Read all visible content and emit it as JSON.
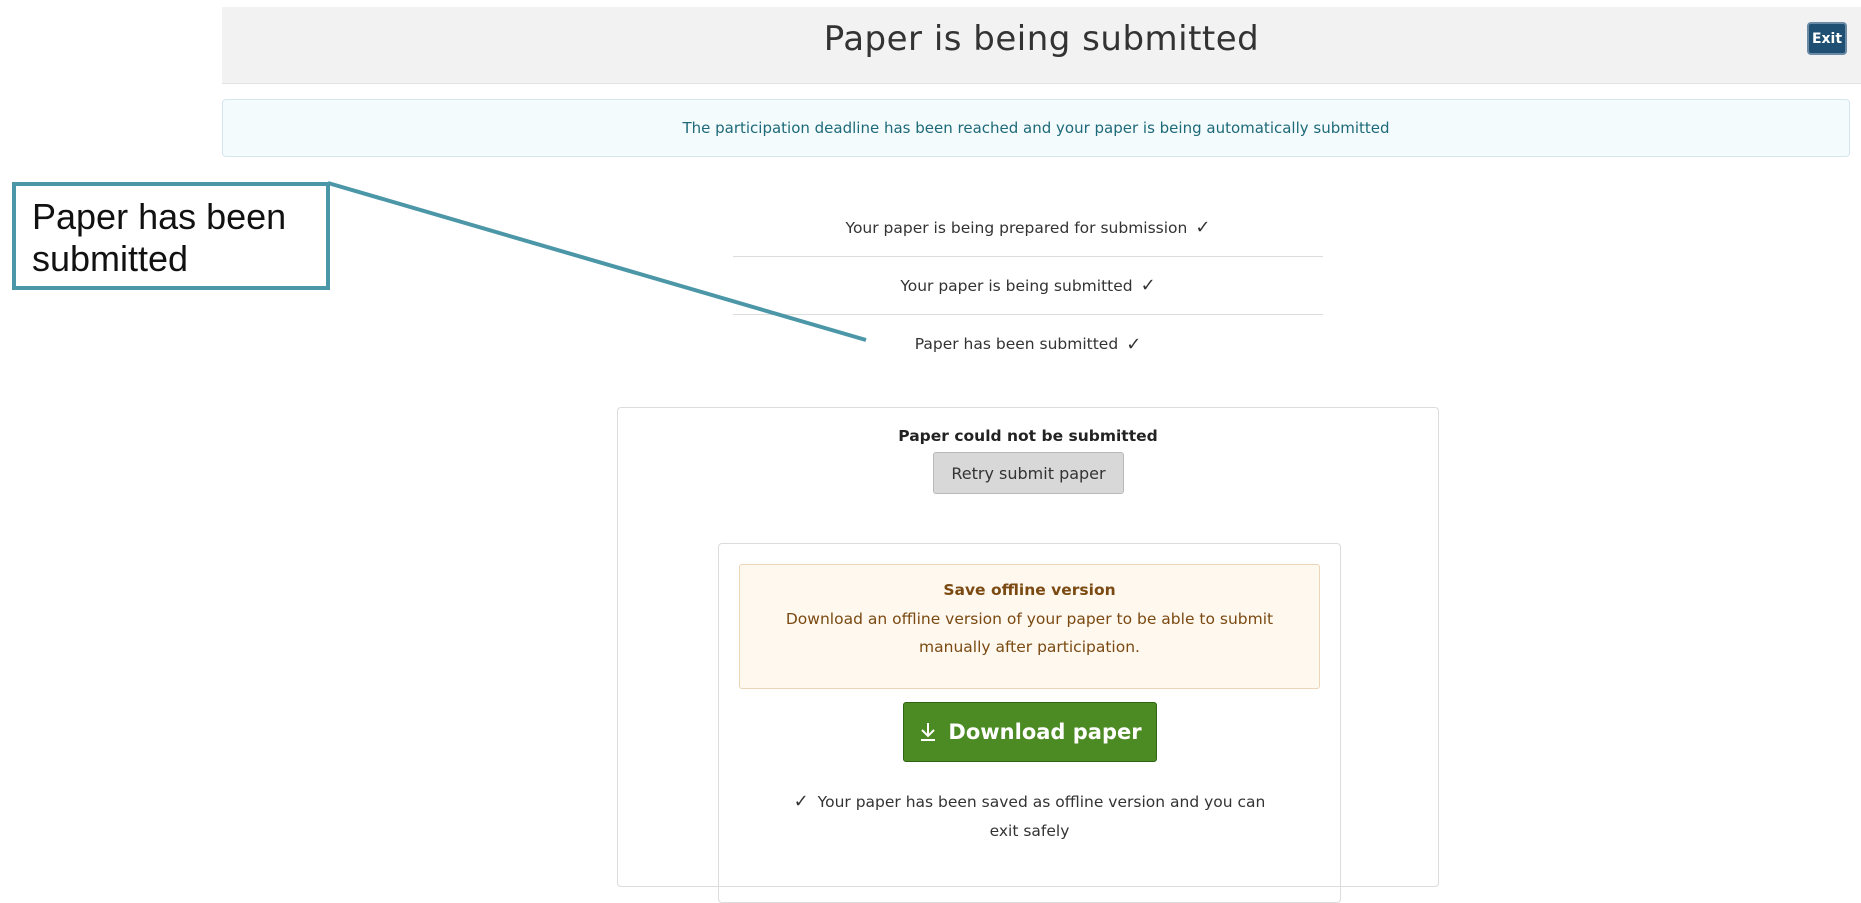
{
  "header": {
    "title": "Paper is being submitted",
    "exit_label": "Exit"
  },
  "banner": {
    "text": "The participation deadline has been reached and your paper is being automatically submitted"
  },
  "steps": [
    {
      "label": "Your paper is being prepared for submission",
      "check": "✓"
    },
    {
      "label": "Your paper is being submitted",
      "check": "✓"
    },
    {
      "label": "Paper has been submitted",
      "check": "✓"
    }
  ],
  "card": {
    "title": "Paper could not be submitted",
    "retry_label": "Retry submit paper"
  },
  "offline": {
    "title": "Save offline version",
    "text": "Download an offline version of your paper to be able to submit manually after participation.",
    "download_label": "Download paper",
    "download_icon": "download-icon",
    "saved_check": "✓",
    "saved_text": "Your paper has been saved as offline version and you can exit safely"
  },
  "callout": {
    "line1": "Paper has been",
    "line2": "submitted"
  },
  "colors": {
    "callout": "#4b97a8",
    "exit_button": "#1f4f73",
    "download_button": "#4c8a24",
    "banner_text": "#1e6a78",
    "warning_text": "#7a4a12"
  }
}
